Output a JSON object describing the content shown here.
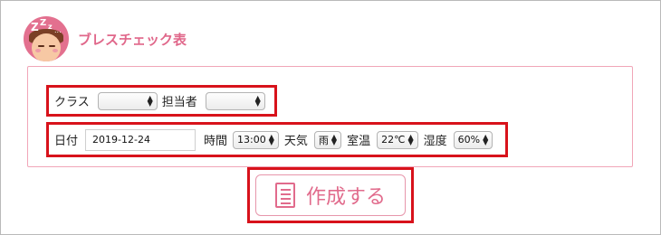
{
  "header": {
    "title": "ブレスチェック表",
    "logo_icon": "sleeping-child-icon",
    "logo_text": "Z Z z ..."
  },
  "row1": {
    "class_label": "クラス",
    "class_value": "",
    "staff_label": "担当者",
    "staff_value": ""
  },
  "row2": {
    "date_label": "日付",
    "date_value": "2019-12-24",
    "time_label": "時間",
    "time_value": "13:00",
    "weather_label": "天気",
    "weather_value": "雨",
    "temp_label": "室温",
    "temp_value": "22℃",
    "humidity_label": "湿度",
    "humidity_value": "60%"
  },
  "action": {
    "create_label": "作成する",
    "icon": "document-list-icon"
  },
  "colors": {
    "accent": "#e0678a",
    "highlight": "#d8121b",
    "panel_border": "#f1a6b8"
  }
}
